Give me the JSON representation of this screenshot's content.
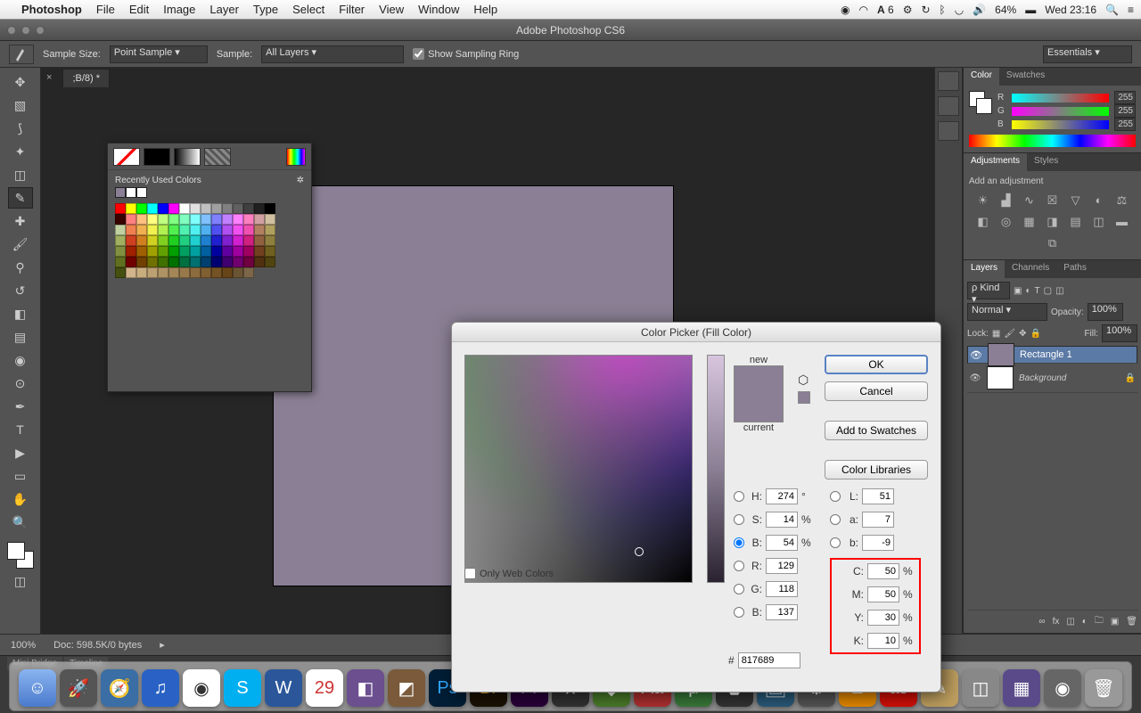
{
  "menubar": {
    "app": "Photoshop",
    "items": [
      "File",
      "Edit",
      "Image",
      "Layer",
      "Type",
      "Select",
      "Filter",
      "View",
      "Window",
      "Help"
    ],
    "battery": "64%",
    "clock": "Wed 23:16"
  },
  "window_title": "Adobe Photoshop CS6",
  "options": {
    "sample_size_label": "Sample Size:",
    "sample_size_value": "Point Sample",
    "sample_label": "Sample:",
    "sample_value": "All Layers",
    "show_sampling_ring": "Show Sampling Ring",
    "workspace": "Essentials"
  },
  "doc_tab": ";B/8) *",
  "swatches_panel": {
    "title": "Recently Used Colors",
    "recent": [
      "#8a7f94",
      "#ffffff",
      "#ffffff"
    ],
    "grid_colors": [
      "#ff0000",
      "#ffff00",
      "#00ff00",
      "#00ffff",
      "#0000ff",
      "#ff00ff",
      "#ffffff",
      "#e0e0e0",
      "#c0c0c0",
      "#a0a0a0",
      "#808080",
      "#606060",
      "#404040",
      "#202020",
      "#000000",
      "#3a0000",
      "#ff8080",
      "#ffc080",
      "#ffff80",
      "#c0ff80",
      "#80ff80",
      "#80ffc0",
      "#80ffff",
      "#80c0ff",
      "#8080ff",
      "#c080ff",
      "#ff80ff",
      "#ff80c0",
      "#d0a0a0",
      "#d0c0a0",
      "#c0d0a0",
      "#f08050",
      "#f0b050",
      "#f0f050",
      "#b0f050",
      "#50f050",
      "#50f0b0",
      "#50f0f0",
      "#50b0f0",
      "#5050f0",
      "#b050f0",
      "#f050f0",
      "#f050b0",
      "#b08060",
      "#b0a060",
      "#a0b060",
      "#d04020",
      "#d08020",
      "#d0d020",
      "#80d020",
      "#20d020",
      "#20d080",
      "#20d0d0",
      "#2080d0",
      "#2020d0",
      "#8020d0",
      "#d020d0",
      "#d02080",
      "#906040",
      "#908040",
      "#809040",
      "#a02000",
      "#a06000",
      "#a0a000",
      "#60a000",
      "#00a000",
      "#00a060",
      "#00a0a0",
      "#0060a0",
      "#0000a0",
      "#6000a0",
      "#a000a0",
      "#a00060",
      "#704020",
      "#706020",
      "#607020",
      "#700000",
      "#704000",
      "#707000",
      "#407000",
      "#007000",
      "#007040",
      "#007070",
      "#004070",
      "#000070",
      "#400070",
      "#700070",
      "#700040",
      "#503010",
      "#504510",
      "#455010",
      "#d2b48c",
      "#c8ad7f",
      "#bca072",
      "#b09365",
      "#a48658",
      "#98794b",
      "#8c6c3e",
      "#805f31",
      "#745224",
      "#684518",
      "#6a5434",
      "#7c664a"
    ]
  },
  "color_panel": {
    "tab_color": "Color",
    "tab_swatches": "Swatches",
    "r_label": "R",
    "r_val": "255",
    "g_label": "G",
    "g_val": "255",
    "b_label": "B",
    "b_val": "255"
  },
  "adjustments": {
    "tab_adj": "Adjustments",
    "tab_styles": "Styles",
    "hint": "Add an adjustment"
  },
  "layers": {
    "tab_layers": "Layers",
    "tab_channels": "Channels",
    "tab_paths": "Paths",
    "kind": "Kind",
    "blend": "Normal",
    "opacity_label": "Opacity:",
    "opacity_val": "100%",
    "lock_label": "Lock:",
    "fill_label": "Fill:",
    "fill_val": "100%",
    "layer1": "Rectangle 1",
    "layer2": "Background"
  },
  "color_picker": {
    "title": "Color Picker (Fill Color)",
    "new_label": "new",
    "current_label": "current",
    "btn_ok": "OK",
    "btn_cancel": "Cancel",
    "btn_add": "Add to Swatches",
    "btn_lib": "Color Libraries",
    "web_only": "Only Web Colors",
    "H_lbl": "H:",
    "H_val": "274",
    "H_unit": "°",
    "S_lbl": "S:",
    "S_val": "14",
    "S_unit": "%",
    "Bv_lbl": "B:",
    "Bv_val": "54",
    "Bv_unit": "%",
    "R_lbl": "R:",
    "R_val": "129",
    "G_lbl": "G:",
    "G_val": "118",
    "B_lbl": "B:",
    "B_val": "137",
    "L_lbl": "L:",
    "L_val": "51",
    "a_lbl": "a:",
    "a_val": "7",
    "b_lbl": "b:",
    "b_val": "-9",
    "C_lbl": "C:",
    "C_val": "50",
    "C_unit": "%",
    "M_lbl": "M:",
    "M_val": "50",
    "M_unit": "%",
    "Y_lbl": "Y:",
    "Y_val": "30",
    "Y_unit": "%",
    "K_lbl": "K:",
    "K_val": "10",
    "K_unit": "%",
    "hex_prefix": "#",
    "hex_val": "817689"
  },
  "status": {
    "zoom": "100%",
    "doc_info": "Doc: 598.5K/0 bytes"
  },
  "bottom_tabs": {
    "mini_bridge": "Mini Bridge",
    "timeline": "Timeline"
  }
}
